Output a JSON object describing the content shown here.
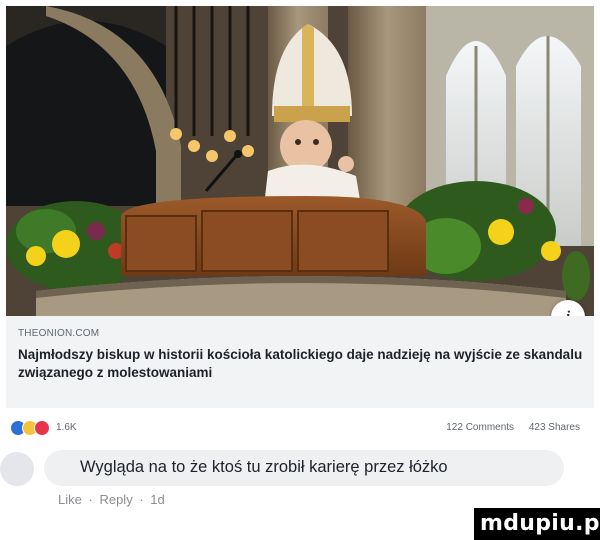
{
  "post": {
    "link_domain": "THEONION.COM",
    "link_title": "Najmłodszy biskup w historii kościoła katolickiego daje nadzieję na wyjście ze skandalu związanego z molestowaniami",
    "info_symbol": "i"
  },
  "reactions": {
    "icons": [
      "like-icon",
      "haha-icon",
      "love-icon"
    ],
    "count": "1.6K",
    "comments": "122 Comments",
    "shares": "423 Shares"
  },
  "comment": {
    "text": "Wygląda na to że ktoś tu zrobił karierę przez łóżko",
    "like_label": "Like",
    "reply_label": "Reply",
    "separator": "·",
    "time": "1d"
  },
  "watermark": {
    "text": "mdupiu.pl"
  },
  "colors": {
    "link_box_bg": "#f2f3f5",
    "comment_bubble_bg": "#eff0f2",
    "like_blue": "#2d6fd6",
    "haha_yellow": "#f5c33b",
    "love_red": "#e8344a"
  }
}
